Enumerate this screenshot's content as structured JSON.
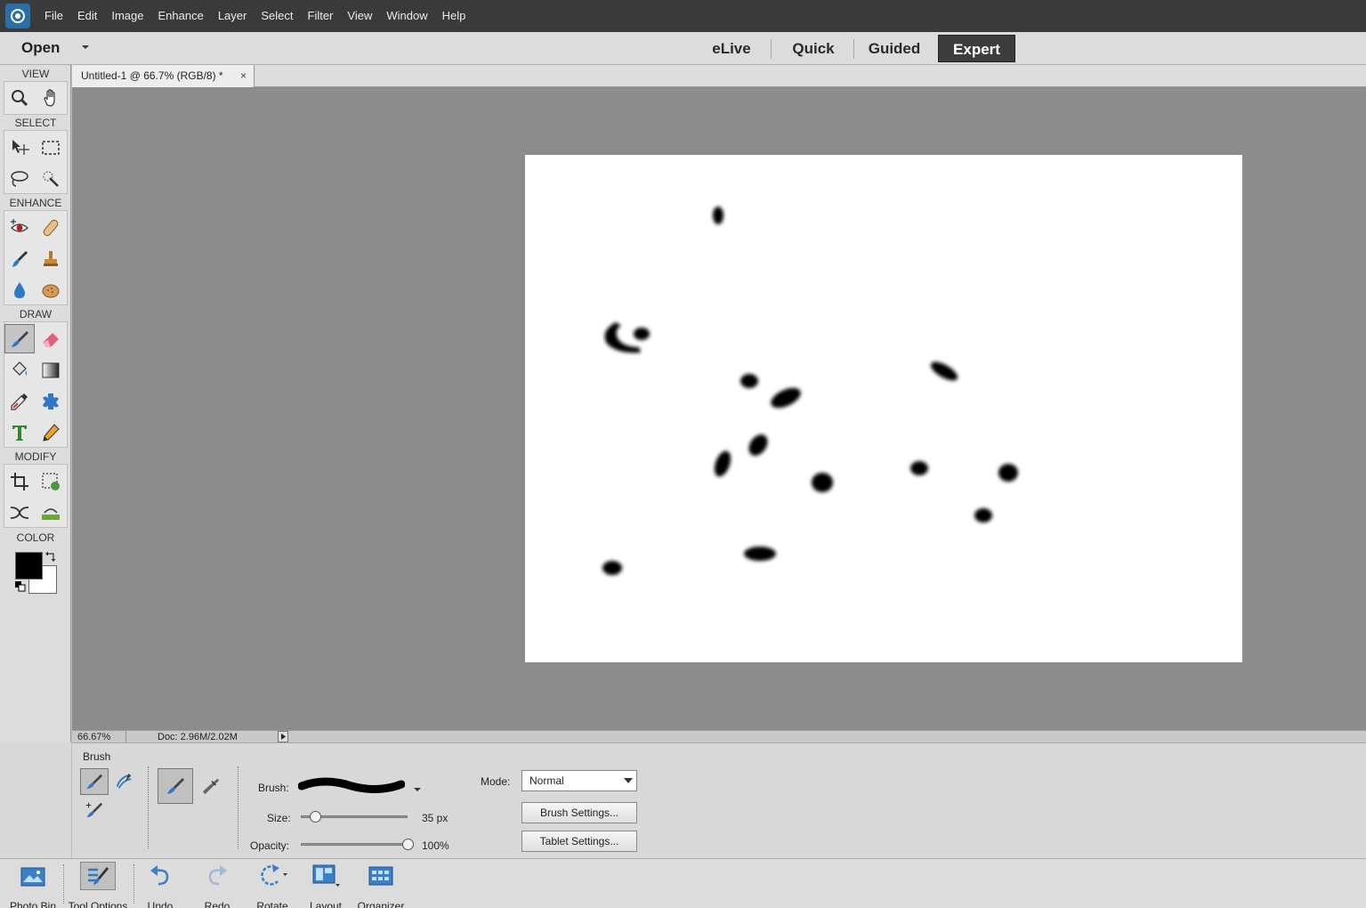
{
  "menubar": {
    "items": [
      "File",
      "Edit",
      "Image",
      "Enhance",
      "Layer",
      "Select",
      "Filter",
      "View",
      "Window",
      "Help"
    ]
  },
  "modebar": {
    "open_label": "Open",
    "tabs": [
      "eLive",
      "Quick",
      "Guided",
      "Expert"
    ],
    "active_tab": "Expert"
  },
  "toolbox": {
    "sections": [
      "VIEW",
      "SELECT",
      "ENHANCE",
      "DRAW",
      "MODIFY",
      "COLOR"
    ],
    "active_tool": "brush-tool",
    "foreground_color": "#000000",
    "background_color": "#ffffff"
  },
  "document": {
    "tab_title": "Untitled-1 @ 66.7% (RGB/8) *",
    "close_glyph": "×"
  },
  "status": {
    "zoom": "66.67%",
    "doc_size": "Doc: 2.96M/2.02M"
  },
  "tool_options": {
    "tool_name": "Brush",
    "brush_label": "Brush:",
    "size_label": "Size:",
    "size_value": "35 px",
    "size_fraction": 0.14,
    "opacity_label": "Opacity:",
    "opacity_value": "100%",
    "opacity_fraction": 1.0,
    "mode_label": "Mode:",
    "mode_value": "Normal",
    "brush_settings_label": "Brush Settings...",
    "tablet_settings_label": "Tablet Settings..."
  },
  "taskbar": {
    "items": [
      "Photo Bin",
      "Tool Options",
      "Undo",
      "Redo",
      "Rotate",
      "Layout",
      "Organizer"
    ],
    "active_item": "Tool Options"
  },
  "colors": {
    "menubar_bg": "#3a3a3a",
    "workspace_bg": "#8c8c8c",
    "accent": "#2b6ea8"
  }
}
